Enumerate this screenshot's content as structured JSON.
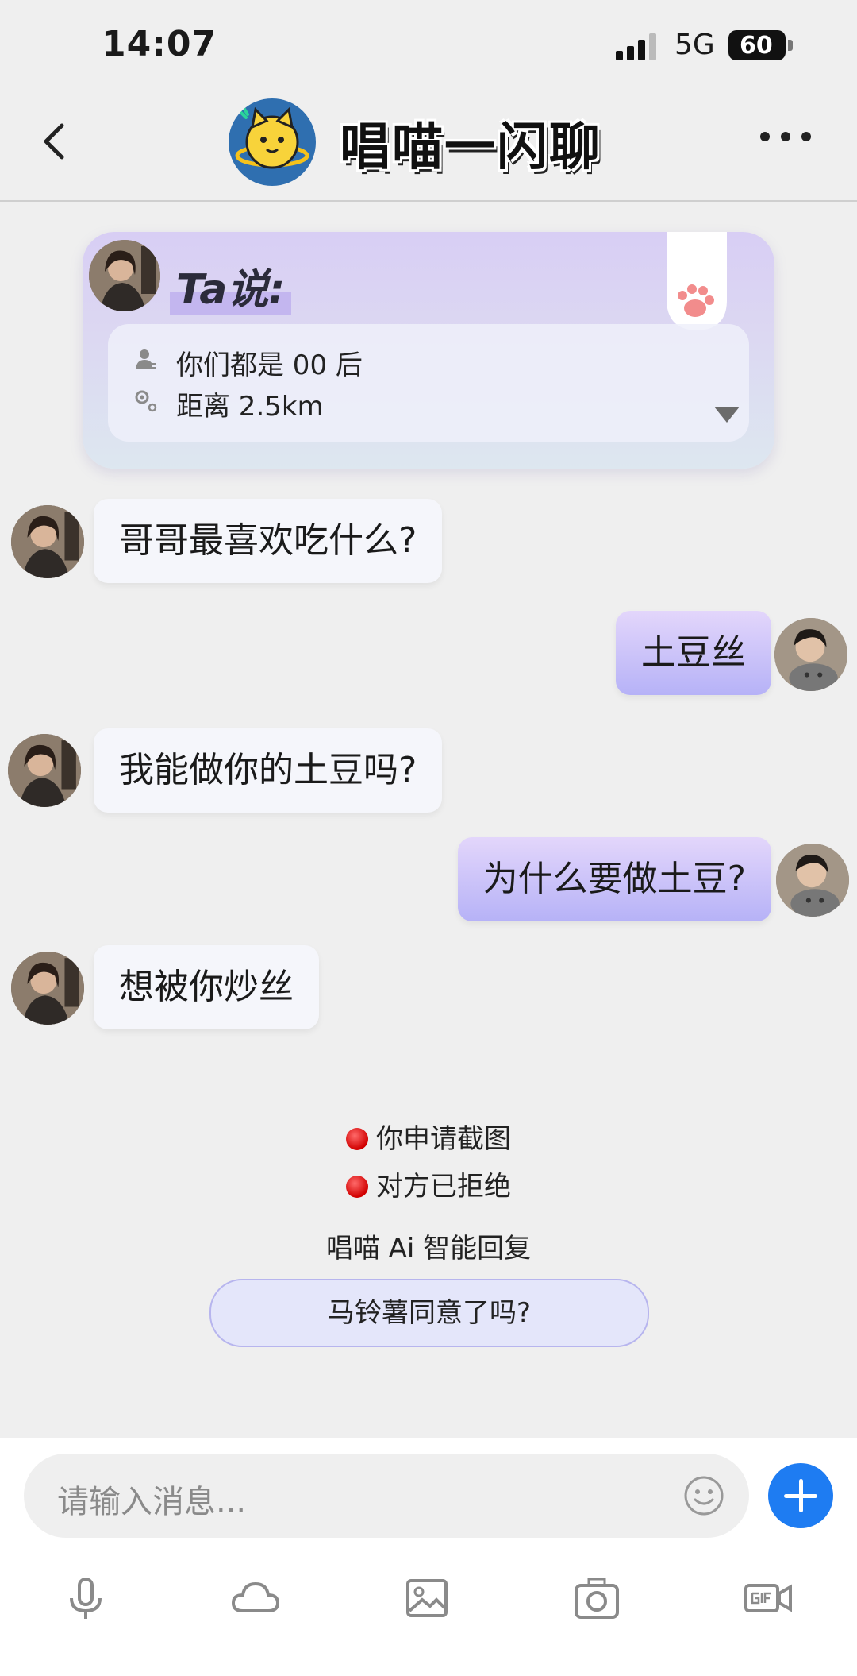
{
  "status_bar": {
    "time": "14:07",
    "network": "5G",
    "battery": "60",
    "battery_level": 0.6
  },
  "header": {
    "title": "唱喵一闪聊"
  },
  "profile_card": {
    "title": "Ta说:",
    "rows": [
      {
        "icon": "person-icon",
        "text": "你们都是 00 后"
      },
      {
        "icon": "location-icon",
        "text": "距离 2.5km"
      }
    ]
  },
  "messages": [
    {
      "side": "left",
      "text": "哥哥最喜欢吃什么?"
    },
    {
      "side": "right",
      "text": "土豆丝"
    },
    {
      "side": "left",
      "text": "我能做你的土豆吗?"
    },
    {
      "side": "right",
      "text": "为什么要做土豆?"
    },
    {
      "side": "left",
      "text": "想被你炒丝"
    }
  ],
  "system_notes": [
    "你申请截图",
    "对方已拒绝"
  ],
  "ai_reply": {
    "label": "唱喵 Ai 智能回复",
    "suggestion": "马铃薯同意了吗?"
  },
  "input": {
    "placeholder": "请输入消息..."
  },
  "toolbar": [
    "microphone-icon",
    "cloud-icon",
    "image-icon",
    "camera-icon",
    "gif-video-icon"
  ],
  "colors": {
    "accent": "#1e7cf2",
    "right_bubble": "#b6b2f7",
    "left_bubble": "#f5f6fb",
    "card": "#d8cef4"
  }
}
